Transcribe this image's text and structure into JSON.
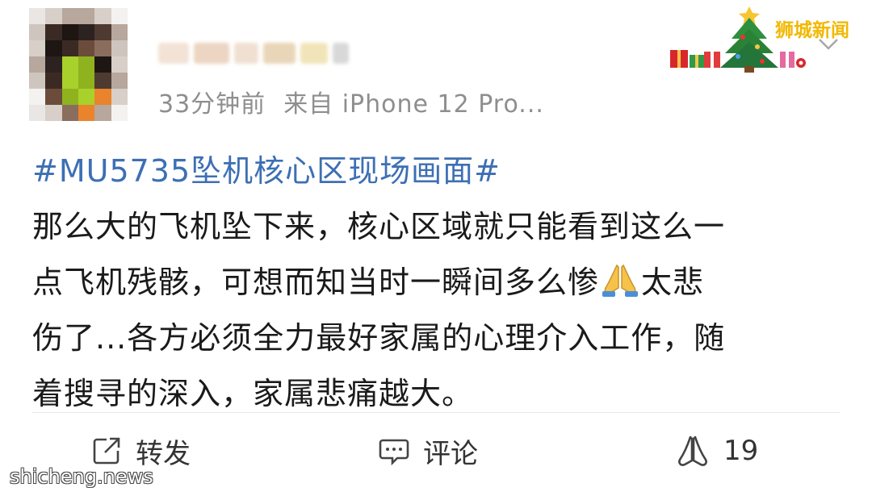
{
  "post": {
    "time_ago": "33分钟前",
    "source": "来自 iPhone 12 Pro...",
    "hashtag": "#MU5735坠机核心区现场画面#",
    "body_lines": [
      "那么大的飞机坠下来，核心区域就只能看到这么一",
      "点飞机残骸，可想而知当时一瞬间多么惨",
      "太悲",
      "伤了...各方必须全力最好家属的心理介入工作，随",
      "着搜寻的深入，家属悲痛越大。"
    ],
    "emoji": "folded-hands"
  },
  "actions": {
    "repost_label": "转发",
    "comment_label": "评论",
    "like_count": "19"
  },
  "watermark": {
    "brand": "狮城新闻",
    "site": "shicheng.news"
  },
  "colors": {
    "hashtag": "#3d6fb4",
    "meta_text": "#8e8e8e",
    "brand_watermark": "#f2b800"
  },
  "icons": [
    "repost-icon",
    "comment-icon",
    "like-icon",
    "chevron-down-icon",
    "christmas-tree-icon",
    "folded-hands-icon"
  ]
}
